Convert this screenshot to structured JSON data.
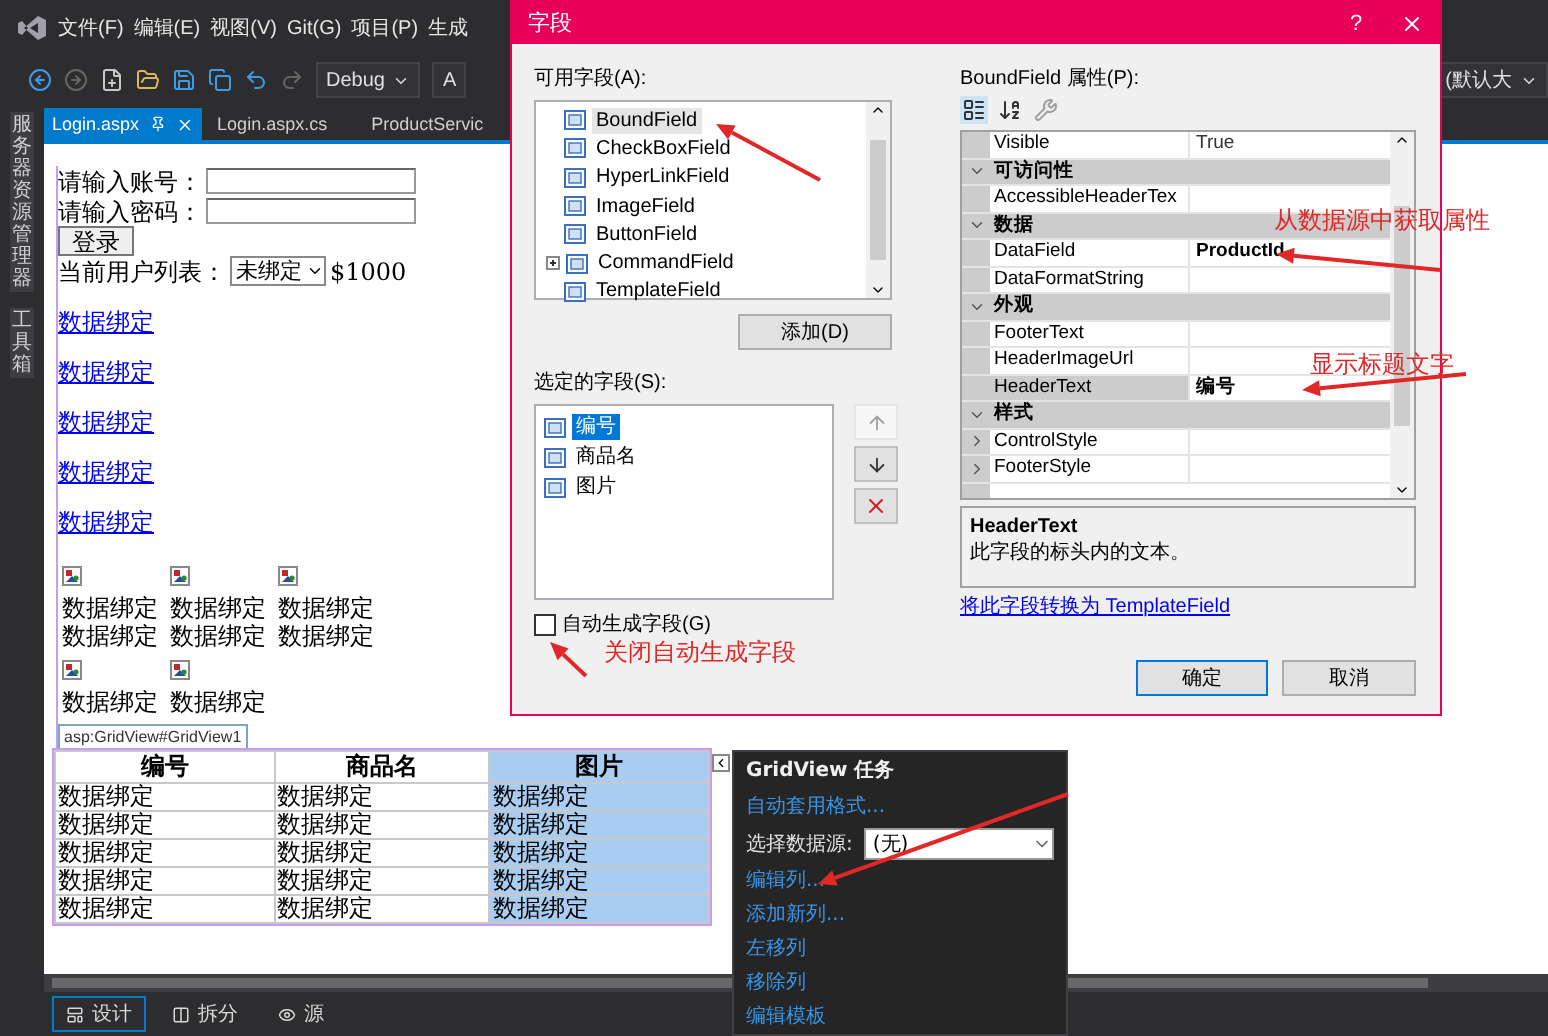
{
  "menu": [
    "文件(F)",
    "编辑(E)",
    "视图(V)",
    "Git(G)",
    "项目(P)",
    "生成"
  ],
  "toolbar": {
    "config": "Debug",
    "platform": "A",
    "size": "(默认大"
  },
  "side_panels": [
    "服务器资源管理器",
    "工具箱"
  ],
  "tabs": [
    {
      "label": "Login.aspx",
      "selected": true
    },
    {
      "label": "Login.aspx.cs",
      "selected": false
    },
    {
      "label": "ProductServic",
      "selected": false
    }
  ],
  "design": {
    "form": {
      "account_label": "请输入账号：",
      "password_label": "请输入密码：",
      "login_button": "登录",
      "users_label": "当前用户列表：",
      "users_select": "未绑定",
      "amount": "$1000"
    },
    "links": [
      "数据绑定",
      "数据绑定",
      "数据绑定",
      "数据绑定",
      "数据绑定"
    ],
    "datalist": [
      [
        {
          "lines": [
            "数据绑定",
            "数据绑定"
          ]
        },
        {
          "lines": [
            "数据绑定",
            "数据绑定"
          ]
        },
        {
          "lines": [
            "数据绑定",
            "数据绑定"
          ]
        }
      ],
      [
        {
          "lines": [
            "数据绑定"
          ]
        },
        {
          "lines": [
            "数据绑定"
          ]
        }
      ]
    ],
    "gridview": {
      "tag": "asp:GridView#GridView1",
      "columns": [
        {
          "label": "编号",
          "selected": false
        },
        {
          "label": "商品名",
          "selected": false
        },
        {
          "label": "图片",
          "selected": true
        }
      ],
      "rows": [
        [
          "数据绑定",
          "数据绑定",
          "数据绑定"
        ],
        [
          "数据绑定",
          "数据绑定",
          "数据绑定"
        ],
        [
          "数据绑定",
          "数据绑定",
          "数据绑定"
        ],
        [
          "数据绑定",
          "数据绑定",
          "数据绑定"
        ],
        [
          "数据绑定",
          "数据绑定",
          "数据绑定"
        ]
      ]
    }
  },
  "view_tabs": [
    {
      "label": "设计",
      "selected": true
    },
    {
      "label": "拆分",
      "selected": false
    },
    {
      "label": "源",
      "selected": false
    }
  ],
  "tasks": {
    "title": "GridView 任务",
    "items": [
      {
        "kind": "link",
        "label": "自动套用格式..."
      },
      {
        "kind": "select",
        "label": "选择数据源:",
        "value": "(无)"
      },
      {
        "kind": "link",
        "label": "编辑列..."
      },
      {
        "kind": "link",
        "label": "添加新列..."
      },
      {
        "kind": "link",
        "label": "左移列"
      },
      {
        "kind": "link",
        "label": "移除列"
      },
      {
        "kind": "link",
        "label": "编辑模板"
      }
    ]
  },
  "dialog": {
    "title": "字段",
    "help": "?",
    "available": {
      "label": "可用字段(A):",
      "items": [
        {
          "label": "BoundField",
          "selected": true,
          "collapsed": false
        },
        {
          "label": "CheckBoxField",
          "selected": false,
          "collapsed": false
        },
        {
          "label": "HyperLinkField",
          "selected": false,
          "collapsed": false
        },
        {
          "label": "ImageField",
          "selected": false,
          "collapsed": false
        },
        {
          "label": "ButtonField",
          "selected": false,
          "collapsed": false
        },
        {
          "label": "CommandField",
          "selected": false,
          "collapsed": true
        },
        {
          "label": "TemplateField",
          "selected": false,
          "collapsed": false
        }
      ]
    },
    "add_button": "添加(D)",
    "selected_fields": {
      "label": "选定的字段(S):",
      "items": [
        {
          "label": "编号",
          "selected": true
        },
        {
          "label": "商品名",
          "selected": false
        },
        {
          "label": "图片",
          "selected": false
        }
      ]
    },
    "move_buttons": [
      {
        "kind": "up",
        "disabled": true
      },
      {
        "kind": "down",
        "disabled": false
      },
      {
        "kind": "delete",
        "disabled": false
      }
    ],
    "auto_generate": {
      "label": "自动生成字段(G)",
      "checked": false
    },
    "properties_label": "BoundField 属性(P):",
    "properties": [
      {
        "kind": "property",
        "name": "Visible",
        "value": "True",
        "bold": false,
        "selected": false
      },
      {
        "kind": "category",
        "name": "可访问性",
        "expanded": true
      },
      {
        "kind": "property",
        "name": "AccessibleHeaderTex",
        "selected": false
      },
      {
        "kind": "category",
        "name": "数据",
        "expanded": true
      },
      {
        "kind": "property",
        "name": "DataField",
        "value": "ProductId",
        "bold": true,
        "selected": false
      },
      {
        "kind": "property",
        "name": "DataFormatString",
        "selected": false
      },
      {
        "kind": "category",
        "name": "外观",
        "expanded": true
      },
      {
        "kind": "property",
        "name": "FooterText",
        "selected": false
      },
      {
        "kind": "property",
        "name": "HeaderImageUrl",
        "selected": false
      },
      {
        "kind": "property",
        "name": "HeaderText",
        "value": "编号",
        "bold": true,
        "selected": true
      },
      {
        "kind": "category",
        "name": "样式",
        "expanded": true
      },
      {
        "kind": "property",
        "name": "ControlStyle",
        "selected": false,
        "expanded": false
      },
      {
        "kind": "property",
        "name": "FooterStyle",
        "selected": false,
        "expanded": false
      }
    ],
    "description": {
      "title": "HeaderText",
      "text": "此字段的标头内的文本。"
    },
    "convert_link": "将此字段转换为 TemplateField",
    "buttons": [
      {
        "label": "确定",
        "default": true
      },
      {
        "label": "取消",
        "default": false
      }
    ]
  },
  "annotations": [
    "从数据源中获取属性",
    "显示标题文字",
    "关闭自动生成字段"
  ]
}
